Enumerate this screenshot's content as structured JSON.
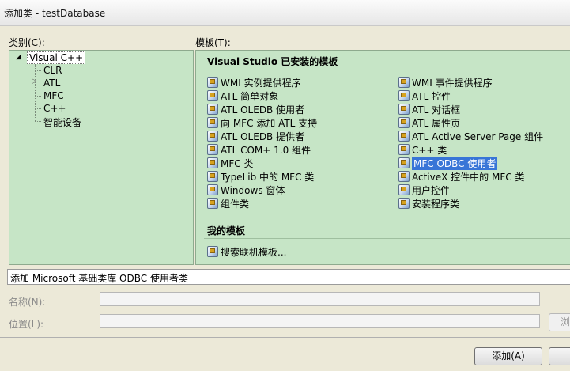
{
  "window": {
    "title": "添加类 - testDatabase"
  },
  "category_label": "类别(C):",
  "template_label": "模板(T):",
  "categories": {
    "root": "Visual C++",
    "children": [
      "CLR",
      "ATL",
      "MFC",
      "C++",
      "智能设备"
    ]
  },
  "templates": {
    "installed_header": "Visual Studio 已安装的模板",
    "left_column": [
      {
        "label": "WMI 实例提供程序",
        "icon": "wmi-icon"
      },
      {
        "label": "ATL 简单对象",
        "icon": "atl-object-icon"
      },
      {
        "label": "ATL OLEDB 使用者",
        "icon": "oledb-consumer-icon"
      },
      {
        "label": "向 MFC 添加 ATL 支持",
        "icon": "mfc-atl-icon"
      },
      {
        "label": "ATL OLEDB 提供者",
        "icon": "oledb-provider-icon"
      },
      {
        "label": "ATL COM+ 1.0 组件",
        "icon": "com-component-icon"
      },
      {
        "label": "MFC 类",
        "icon": "mfc-class-icon"
      },
      {
        "label": "TypeLib 中的 MFC 类",
        "icon": "typelib-icon"
      },
      {
        "label": "Windows 窗体",
        "icon": "windows-form-icon"
      },
      {
        "label": "组件类",
        "icon": "component-class-icon"
      }
    ],
    "right_column": [
      {
        "label": "WMI 事件提供程序",
        "icon": "wmi-event-icon"
      },
      {
        "label": "ATL 控件",
        "icon": "atl-control-icon"
      },
      {
        "label": "ATL 对话框",
        "icon": "atl-dialog-icon"
      },
      {
        "label": "ATL 属性页",
        "icon": "atl-property-page-icon"
      },
      {
        "label": "ATL Active Server Page 组件",
        "icon": "asp-component-icon"
      },
      {
        "label": "C++ 类",
        "icon": "cpp-class-icon"
      },
      {
        "label": "MFC ODBC 使用者",
        "icon": "mfc-odbc-icon",
        "selected": true
      },
      {
        "label": "ActiveX 控件中的 MFC 类",
        "icon": "activex-icon"
      },
      {
        "label": "用户控件",
        "icon": "user-control-icon"
      },
      {
        "label": "安装程序类",
        "icon": "installer-class-icon"
      }
    ],
    "my_templates_header": "我的模板",
    "search_online": "搜索联机模板..."
  },
  "description": "添加 Microsoft 基础类库 ODBC 使用者类",
  "name_label": "名称(N):",
  "location_label": "位置(L):",
  "browse_label": "浏",
  "add_button": "添加(A)"
}
